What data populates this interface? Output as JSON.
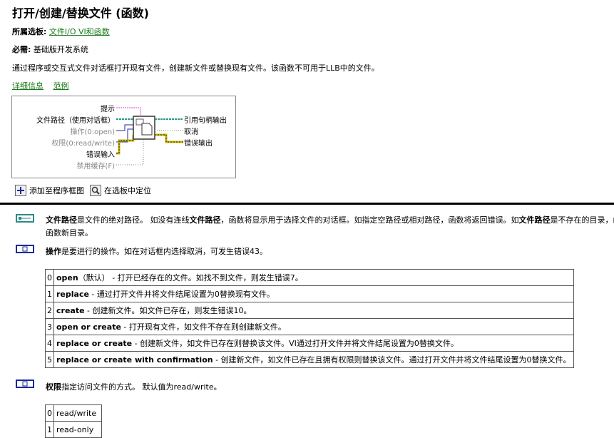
{
  "title": "打开/创建/替换文件 (函数)",
  "palette": {
    "label": "所属选板:",
    "link": "文件I/O VI和函数"
  },
  "requires": {
    "label": "必需:",
    "value": "基础版开发系统"
  },
  "description": "通过程序或交互式文件对话框打开现有文件，创建新文件或替换现有文件。该函数不可用于LLB中的文件。",
  "links": {
    "details": "详细信息",
    "examples": "范例"
  },
  "diagram": {
    "inputs": [
      "提示",
      "文件路径（使用对话框）",
      "操作(0:open)",
      "权限(0:read/write)",
      "错误输入",
      "禁用缓存(F)"
    ],
    "outputs": [
      "引用句柄输出",
      "取消",
      "错误输出"
    ]
  },
  "actions": {
    "add": "添加至程序框图",
    "locate": "在选板中定位"
  },
  "params": {
    "file_path": {
      "name": "文件路径",
      "text1": "是文件的绝对路径。 如没有连线",
      "name2": "文件路径",
      "text2": "，函数将显示用于选择文件的对话框。如指定空路径或相对路径，函数将返回错误。如",
      "name3": "文件路径",
      "text3": "是不存在的目录，函数",
      "line2": "函数新目录。"
    },
    "operation": {
      "name": "操作",
      "text": "是要进行的操作。如在对话框内选择取消，可发生错误43。",
      "options": [
        {
          "n": "0",
          "name": "open",
          "text": "（默认） - 打开已经存在的文件。如找不到文件，则发生错误7。"
        },
        {
          "n": "1",
          "name": "replace",
          "text": " - 通过打开文件并将文件结尾设置为0替换现有文件。"
        },
        {
          "n": "2",
          "name": "create",
          "text": " - 创建新文件。如文件已存在，则发生错误10。"
        },
        {
          "n": "3",
          "name": "open or create",
          "text": " - 打开现有文件，如文件不存在则创建新文件。"
        },
        {
          "n": "4",
          "name": "replace or create",
          "text": " - 创建新文件，如文件已存在则替换该文件。VI通过打开文件并将文件结尾设置为0替换文件。"
        },
        {
          "n": "5",
          "name": "replace or create with confirmation",
          "text": " - 创建新文件，如文件已存在且拥有权限则替换该文件。通过打开文件并将文件结尾设置为0替换文件。"
        }
      ]
    },
    "permission": {
      "name": "权限",
      "text": "指定访问文件的方式。 默认值为read/write。",
      "options": [
        {
          "n": "0",
          "text": "read/write"
        },
        {
          "n": "1",
          "text": "read-only"
        }
      ]
    }
  },
  "colors": {
    "link": "#1a7a1a",
    "terminal_border": "#1a2a9a",
    "wire_pink": "#e040e0",
    "wire_path": "#2a9a8a",
    "wire_enum": "#1a2a9a",
    "wire_error": "#c8b400"
  }
}
